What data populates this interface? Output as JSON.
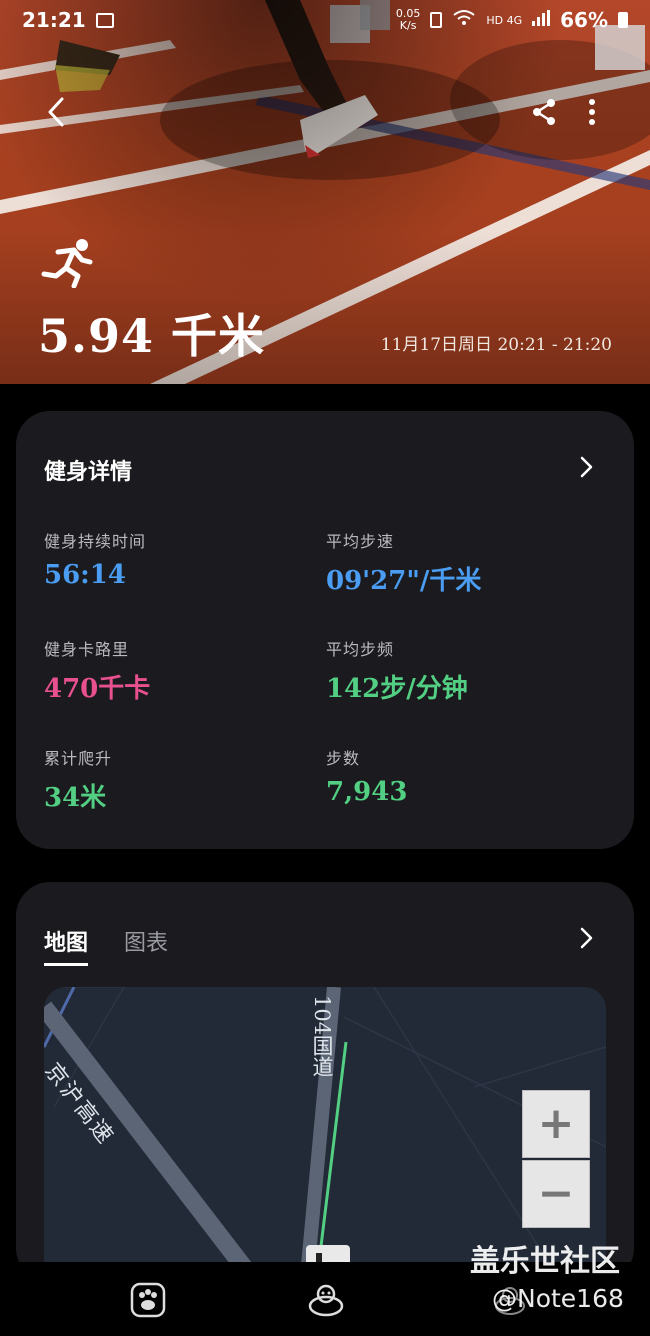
{
  "status_bar": {
    "time": "21:21",
    "net_speed": "0.05\nK/s",
    "network": "HD 4G",
    "battery": "66%"
  },
  "hero": {
    "distance": "5.94 千米",
    "datetime": "11月17日周日 20:21 - 21:20"
  },
  "details": {
    "title": "健身详情",
    "stats": [
      {
        "label": "健身持续时间",
        "value": "56:14",
        "color": "#4a9df2"
      },
      {
        "label": "平均步速",
        "value": "09'27\"/千米",
        "color": "#4a9df2"
      },
      {
        "label": "健身卡路里",
        "value": "470千卡",
        "color": "#e8508f"
      },
      {
        "label": "平均步频",
        "value": "142步/分钟",
        "color": "#52cf82"
      },
      {
        "label": "累计爬升",
        "value": "34米",
        "color": "#52cf82"
      },
      {
        "label": "步数",
        "value": "7,943",
        "color": "#52cf82"
      }
    ]
  },
  "map_card": {
    "tabs": [
      {
        "label": "地图",
        "active": true
      },
      {
        "label": "图表",
        "active": false
      }
    ],
    "map_labels": {
      "highway": "京沪高速",
      "road": "104国道"
    },
    "zoom_in": "+",
    "zoom_out": "−"
  },
  "watermark": {
    "site": "盖乐世社区",
    "user": "@Note168"
  },
  "icons": {
    "back": "chevron-left-icon",
    "share": "share-icon",
    "more": "more-vertical-icon",
    "activity": "running-icon",
    "nav_1": "paw-app-icon",
    "nav_2": "mascot-app-icon",
    "nav_3": "mascot-alt-app-icon"
  }
}
